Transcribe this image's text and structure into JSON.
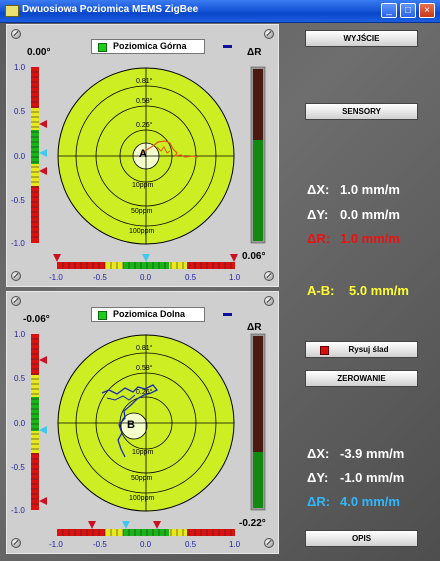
{
  "window": {
    "title": "Dwuosiowa Poziomica MEMS ZigBee",
    "minimize": "_",
    "maximize": "□",
    "close": "×"
  },
  "top_panel": {
    "legend": "Poziomica Górna",
    "angle_left": "0.00°",
    "angle_right": "0.06°",
    "delta_r_label": "ΔR",
    "center_letter": "A",
    "ring_labels": [
      "0.81°",
      "0.58°",
      "0.26°",
      "10ppm",
      "50ppm",
      "100ppm"
    ],
    "vscale": [
      "1.0",
      "0.5",
      "0.0",
      "-0.5",
      "-1.0"
    ],
    "hscale": [
      "-1.0",
      "-0.5",
      "0.0",
      "0.5",
      "1.0"
    ],
    "bar_fill": 0.55
  },
  "bottom_panel": {
    "legend": "Poziomica Dolna",
    "angle_left": "-0.06°",
    "angle_right": "-0.22°",
    "delta_r_label": "ΔR",
    "center_letter": "B",
    "ring_labels": [
      "0.81°",
      "0.58°",
      "0.26°",
      "10ppm",
      "50ppm",
      "100ppm"
    ],
    "vscale": [
      "1.0",
      "0.5",
      "0.0",
      "-0.5",
      "-1.0"
    ],
    "hscale": [
      "-1.0",
      "-0.5",
      "0.0",
      "0.5",
      "1.0"
    ],
    "bar_fill": 0.32
  },
  "buttons": {
    "exit": "WYJŚCIE",
    "sensors": "SENSORY",
    "draw_trace": "Rysuj ślad",
    "zero": "ZEROWANIE",
    "description": "OPIS"
  },
  "readout_top": {
    "dx_label": "ΔX:",
    "dx_value": "1.0 mm/m",
    "dy_label": "ΔY:",
    "dy_value": "0.0 mm/m",
    "dr_label": "ΔR:",
    "dr_value": "1.0 mm/m"
  },
  "readout_ab": {
    "label": "A-B:",
    "value": "5.0 mm/m"
  },
  "readout_bottom": {
    "dx_label": "ΔX:",
    "dx_value": "-3.9 mm/m",
    "dy_label": "ΔY:",
    "dy_value": "-1.0 mm/m",
    "dr_label": "ΔR:",
    "dr_value": "4.0 mm/m"
  },
  "colors": {
    "dial": "#ccee22",
    "accent_red": "#ee1010",
    "accent_yellow": "#ffff30",
    "accent_cyan": "#30b8ff",
    "marker_red": "#cc1020",
    "marker_cyan": "#40c8f0"
  }
}
